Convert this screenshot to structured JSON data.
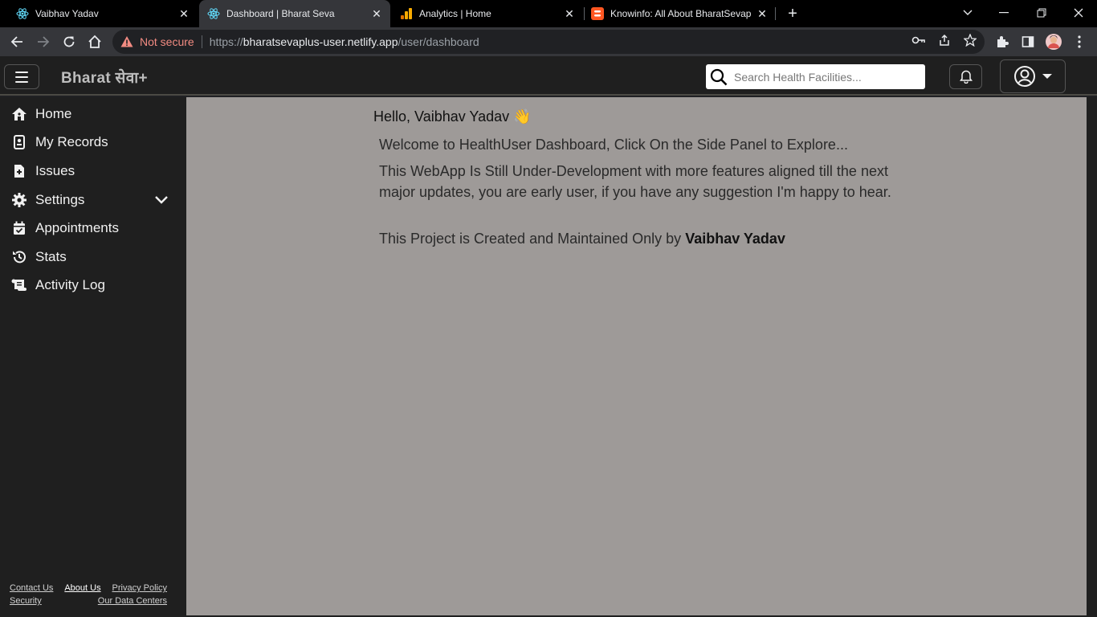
{
  "browser": {
    "tabs": [
      {
        "title": "Vaibhav Yadav",
        "icon": "react-icon",
        "active": false
      },
      {
        "title": "Dashboard | Bharat Seva",
        "icon": "react-icon",
        "active": true
      },
      {
        "title": "Analytics | Home",
        "icon": "analytics-icon",
        "active": false
      },
      {
        "title": "Knowinfo: All About BharatSevap",
        "icon": "blogger-icon",
        "active": false
      }
    ],
    "security_text": "Not secure",
    "url_scheme": "https://",
    "url_host": "bharatsevaplus-user.netlify.app",
    "url_path": "/user/dashboard"
  },
  "app": {
    "brand": "Bharat सेवा+",
    "search_placeholder": "Search Health Facilities..."
  },
  "sidebar": {
    "items": [
      {
        "label": "Home",
        "icon": "home-icon"
      },
      {
        "label": "My Records",
        "icon": "records-icon"
      },
      {
        "label": "Issues",
        "icon": "issues-icon"
      },
      {
        "label": "Settings",
        "icon": "gear-icon"
      },
      {
        "label": "Appointments",
        "icon": "calendar-icon"
      },
      {
        "label": "Stats",
        "icon": "history-icon"
      },
      {
        "label": "Activity Log",
        "icon": "scroll-icon"
      }
    ],
    "footer": {
      "contact": "Contact Us",
      "about": "About Us",
      "privacy": "Privacy Policy",
      "security": "Security",
      "datacenters": "Our Data Centers"
    }
  },
  "main": {
    "greeting": "Hello, Vaibhav Yadav 👋",
    "welcome": "Welcome to HealthUser Dashboard, Click On the Side Panel to Explore...",
    "notice": "This WebApp Is Still Under-Development with more features aligned till the next major updates, you are early user, if you have any suggestion I'm happy to hear.",
    "credit_prefix": "This Project is Created and Maintained Only by ",
    "credit_name": "Vaibhav Yadav"
  }
}
